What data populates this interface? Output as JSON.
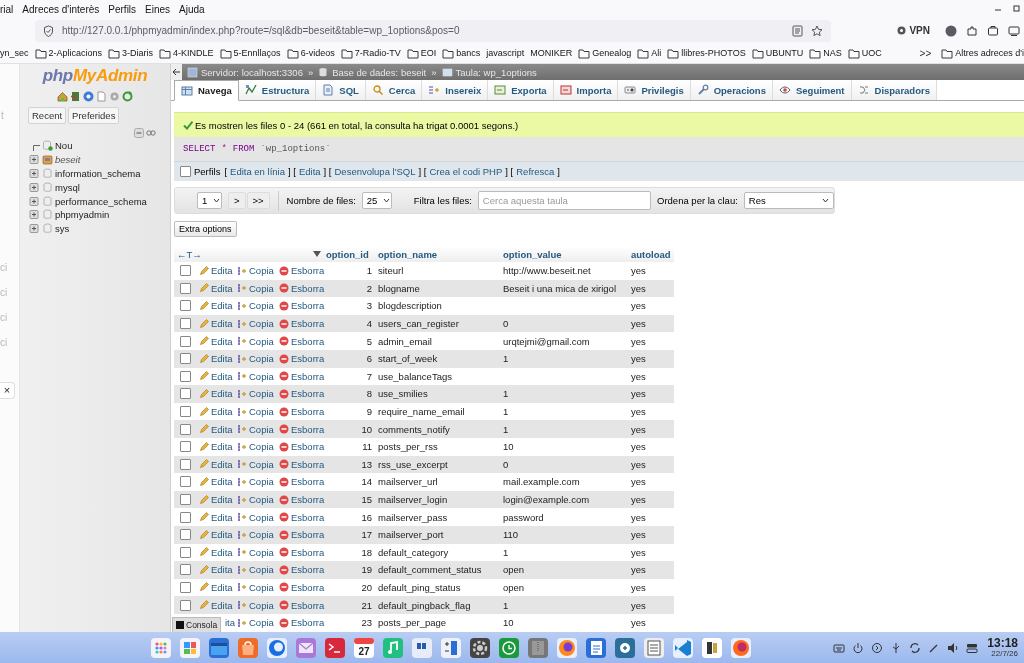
{
  "browser": {
    "menu": [
      "rial",
      "Adreces d'interès",
      "Perfils",
      "Eines",
      "Ajuda"
    ],
    "url": "http://127.0.0.1/phpmyadmin/index.php?route=/sql&db=beseit&table=wp_1options&pos=0",
    "vpn": "VPN",
    "bookmarks": [
      {
        "label": "yn_sec",
        "folder": false
      },
      {
        "label": "2-Aplicacions",
        "folder": true
      },
      {
        "label": "3-Diaris",
        "folder": true
      },
      {
        "label": "4-KINDLE",
        "folder": true
      },
      {
        "label": "5-Ennllaços",
        "folder": true
      },
      {
        "label": "6-videos",
        "folder": true
      },
      {
        "label": "7-Radio-TV",
        "folder": true
      },
      {
        "label": "EOI",
        "folder": true
      },
      {
        "label": "bancs",
        "folder": true
      },
      {
        "label": "javascript",
        "folder": false
      },
      {
        "label": "MONIKER",
        "folder": false
      },
      {
        "label": "Genealog",
        "folder": true
      },
      {
        "label": "Ali",
        "folder": true
      },
      {
        "label": "llibres-PHOTOS",
        "folder": true
      },
      {
        "label": "UBUNTU",
        "folder": true
      },
      {
        "label": "NAS",
        "folder": true
      },
      {
        "label": "UOC",
        "folder": true
      }
    ],
    "bookmarks_more": ">>",
    "other_bookmarks": "Altres adreces d'i"
  },
  "left_stub": {
    "texts": [
      "t",
      "ci",
      "ci",
      "ci",
      "ci"
    ],
    "close": "×"
  },
  "navigation": {
    "logo": [
      "php",
      "MyAdmin"
    ],
    "tabs": [
      "Recent",
      "Preferides"
    ],
    "tree": [
      {
        "label": "Nou",
        "kind": "new",
        "selected": false
      },
      {
        "label": "beseit",
        "kind": "db",
        "selected": true
      },
      {
        "label": "information_schema",
        "kind": "db",
        "selected": false
      },
      {
        "label": "mysql",
        "kind": "db",
        "selected": false
      },
      {
        "label": "performance_schema",
        "kind": "db",
        "selected": false
      },
      {
        "label": "phpmyadmin",
        "kind": "db",
        "selected": false
      },
      {
        "label": "sys",
        "kind": "db",
        "selected": false
      }
    ]
  },
  "breadcrumb": [
    {
      "kind": "server",
      "text": "Servidor: localhost:3306"
    },
    {
      "kind": "sep",
      "text": "»"
    },
    {
      "kind": "database",
      "text": "Base de dades: beseit"
    },
    {
      "kind": "sep",
      "text": "»"
    },
    {
      "kind": "table",
      "text": "Taula: wp_1options"
    }
  ],
  "tabs": [
    {
      "label": "Navega",
      "selected": true
    },
    {
      "label": "Estructura",
      "selected": false
    },
    {
      "label": "SQL",
      "selected": false
    },
    {
      "label": "Cerca",
      "selected": false
    },
    {
      "label": "Insereix",
      "selected": false
    },
    {
      "label": "Exporta",
      "selected": false
    },
    {
      "label": "Importa",
      "selected": false
    },
    {
      "label": "Privilegis",
      "selected": false
    },
    {
      "label": "Operacions",
      "selected": false
    },
    {
      "label": "Seguiment",
      "selected": false
    },
    {
      "label": "Disparadors",
      "selected": false
    }
  ],
  "message": "Es mostren les files 0 - 24 (661 en total, la consulta ha trigat 0.0001 segons.)",
  "sql": [
    {
      "kind": "keyword",
      "text": "SELECT"
    },
    {
      "kind": "operator",
      "text": "*"
    },
    {
      "kind": "keyword",
      "text": "FROM"
    },
    {
      "kind": "identifier",
      "text": "`wp_1options`"
    }
  ],
  "profiling": {
    "label": "Perfils",
    "checked": false,
    "items": [
      {
        "kind": "bracket",
        "text": "["
      },
      {
        "kind": "link",
        "text": "Edita en línia"
      },
      {
        "kind": "bracket",
        "text": "] ["
      },
      {
        "kind": "link",
        "text": "Edita"
      },
      {
        "kind": "bracket",
        "text": "] ["
      },
      {
        "kind": "link",
        "text": "Desenvolupa l'SQL"
      },
      {
        "kind": "bracket",
        "text": "] ["
      },
      {
        "kind": "link",
        "text": "Crea el codi PHP"
      },
      {
        "kind": "bracket",
        "text": "] ["
      },
      {
        "kind": "link",
        "text": "Refresca"
      },
      {
        "kind": "bracket",
        "text": "]"
      }
    ]
  },
  "pager": {
    "page": "1",
    "next": ">",
    "last": ">>",
    "rows_label": "Nombre de files:",
    "rows": "25",
    "filter_label": "Filtra les files:",
    "filter_placeholder": "Cerca aquesta taula",
    "sort_label": "Ordena per la clau:",
    "sort": "Res"
  },
  "extra_options": "Extra options",
  "table": {
    "arrows": "←T→",
    "columns": [
      "option_id",
      "option_name",
      "option_value",
      "autoload"
    ],
    "rows": [
      {
        "partial": false,
        "checked": false,
        "edit": "Edita",
        "copy": "Copia",
        "delete": "Esborra",
        "cells": [
          "1",
          "siteurl",
          "http://www.beseit.net",
          "yes"
        ]
      },
      {
        "partial": false,
        "checked": false,
        "edit": "Edita",
        "copy": "Copia",
        "delete": "Esborra",
        "cells": [
          "2",
          "blogname",
          "Beseit i una mica de xirigol",
          "yes"
        ]
      },
      {
        "partial": false,
        "checked": false,
        "edit": "Edita",
        "copy": "Copia",
        "delete": "Esborra",
        "cells": [
          "3",
          "blogdescription",
          null,
          "yes"
        ]
      },
      {
        "partial": false,
        "checked": false,
        "edit": "Edita",
        "copy": "Copia",
        "delete": "Esborra",
        "cells": [
          "4",
          "users_can_register",
          "0",
          "yes"
        ]
      },
      {
        "partial": false,
        "checked": false,
        "edit": "Edita",
        "copy": "Copia",
        "delete": "Esborra",
        "cells": [
          "5",
          "admin_email",
          "urqtejmi@gmail.com",
          "yes"
        ]
      },
      {
        "partial": false,
        "checked": false,
        "edit": "Edita",
        "copy": "Copia",
        "delete": "Esborra",
        "cells": [
          "6",
          "start_of_week",
          "1",
          "yes"
        ]
      },
      {
        "partial": false,
        "checked": false,
        "edit": "Edita",
        "copy": "Copia",
        "delete": "Esborra",
        "cells": [
          "7",
          "use_balanceTags",
          null,
          "yes"
        ]
      },
      {
        "partial": false,
        "checked": false,
        "edit": "Edita",
        "copy": "Copia",
        "delete": "Esborra",
        "cells": [
          "8",
          "use_smilies",
          "1",
          "yes"
        ]
      },
      {
        "partial": false,
        "checked": false,
        "edit": "Edita",
        "copy": "Copia",
        "delete": "Esborra",
        "cells": [
          "9",
          "require_name_email",
          "1",
          "yes"
        ]
      },
      {
        "partial": false,
        "checked": false,
        "edit": "Edita",
        "copy": "Copia",
        "delete": "Esborra",
        "cells": [
          "10",
          "comments_notify",
          "1",
          "yes"
        ]
      },
      {
        "partial": false,
        "checked": false,
        "edit": "Edita",
        "copy": "Copia",
        "delete": "Esborra",
        "cells": [
          "11",
          "posts_per_rss",
          "10",
          "yes"
        ]
      },
      {
        "partial": false,
        "checked": false,
        "edit": "Edita",
        "copy": "Copia",
        "delete": "Esborra",
        "cells": [
          "13",
          "rss_use_excerpt",
          "0",
          "yes"
        ]
      },
      {
        "partial": false,
        "checked": false,
        "edit": "Edita",
        "copy": "Copia",
        "delete": "Esborra",
        "cells": [
          "14",
          "mailserver_url",
          "mail.example.com",
          "yes"
        ]
      },
      {
        "partial": false,
        "checked": false,
        "edit": "Edita",
        "copy": "Copia",
        "delete": "Esborra",
        "cells": [
          "15",
          "mailserver_login",
          "login@example.com",
          "yes"
        ]
      },
      {
        "partial": false,
        "checked": false,
        "edit": "Edita",
        "copy": "Copia",
        "delete": "Esborra",
        "cells": [
          "16",
          "mailserver_pass",
          "password",
          "yes"
        ]
      },
      {
        "partial": false,
        "checked": false,
        "edit": "Edita",
        "copy": "Copia",
        "delete": "Esborra",
        "cells": [
          "17",
          "mailserver_port",
          "110",
          "yes"
        ]
      },
      {
        "partial": false,
        "checked": false,
        "edit": "Edita",
        "copy": "Copia",
        "delete": "Esborra",
        "cells": [
          "18",
          "default_category",
          "1",
          "yes"
        ]
      },
      {
        "partial": false,
        "checked": false,
        "edit": "Edita",
        "copy": "Copia",
        "delete": "Esborra",
        "cells": [
          "19",
          "default_comment_status",
          "open",
          "yes"
        ]
      },
      {
        "partial": false,
        "checked": false,
        "edit": "Edita",
        "copy": "Copia",
        "delete": "Esborra",
        "cells": [
          "20",
          "default_ping_status",
          "open",
          "yes"
        ]
      },
      {
        "partial": false,
        "checked": false,
        "edit": "Edita",
        "copy": "Copia",
        "delete": "Esborra",
        "cells": [
          "21",
          "default_pingback_flag",
          "1",
          "yes"
        ]
      },
      {
        "partial": true,
        "edit": "ita",
        "copy": "Copia",
        "delete": "Esborra",
        "cells": [
          "23",
          "posts_per_page",
          "10",
          "yes"
        ]
      }
    ]
  },
  "console": "Consola",
  "taskbar": {
    "calendar_day": "27",
    "time": "13:18",
    "date": "22/7/26"
  }
}
